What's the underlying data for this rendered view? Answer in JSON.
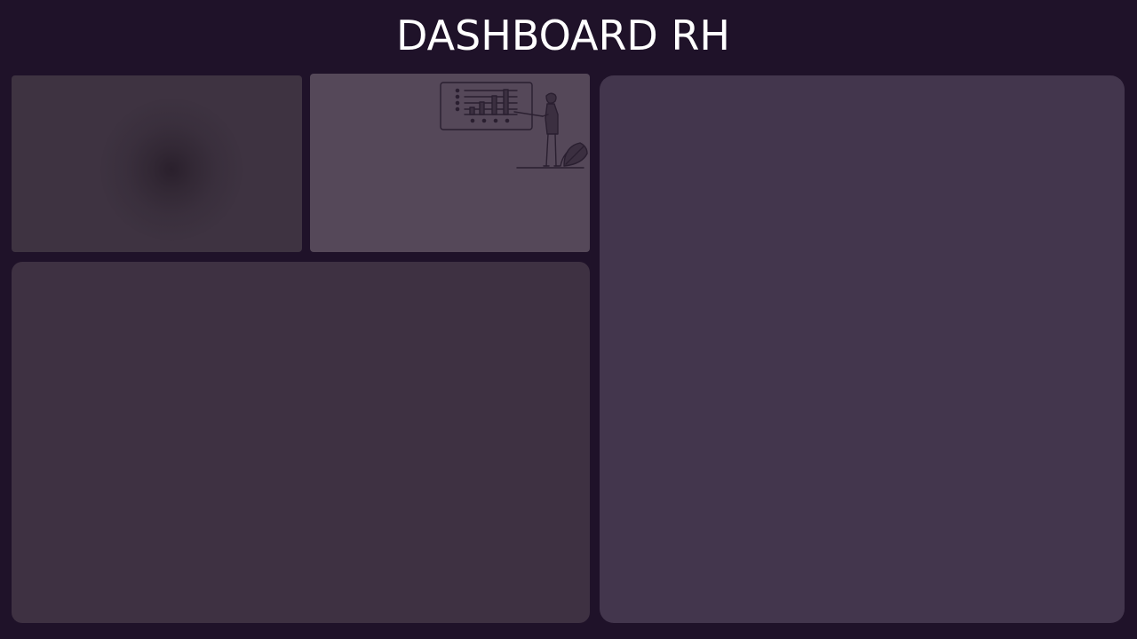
{
  "header": {
    "title": "DASHBOARD RH"
  },
  "illustration": {
    "icon": "presenter-with-chart-illustration"
  },
  "colors": {
    "background": "#1f1229",
    "title": "#ffffff",
    "panel_top_left": "#3e3341",
    "panel_top_middle": "#554859",
    "panel_bottom_left": "#3e3142",
    "panel_right": "#43364d",
    "line_art": "#2a1f30"
  }
}
